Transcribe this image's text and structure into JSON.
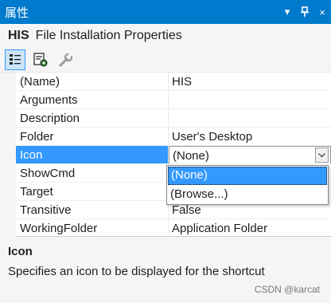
{
  "panel": {
    "title": "属性",
    "dropdown_glyph": "▾",
    "pin_glyph": "pin-icon",
    "close_glyph": "×"
  },
  "object": {
    "name": "HIS",
    "type": "File Installation Properties"
  },
  "toolbar": {
    "tools": [
      {
        "name": "categorized-icon",
        "active": true
      },
      {
        "name": "property-pages-icon",
        "active": false
      },
      {
        "name": "wrench-icon",
        "active": false
      }
    ]
  },
  "properties": [
    {
      "name": "(Name)",
      "value": "HIS"
    },
    {
      "name": "Arguments",
      "value": ""
    },
    {
      "name": "Description",
      "value": ""
    },
    {
      "name": "Folder",
      "value": "User's Desktop"
    },
    {
      "name": "Icon",
      "value": "(None)",
      "selected": true
    },
    {
      "name": "ShowCmd",
      "value": ""
    },
    {
      "name": "Target",
      "value": ""
    },
    {
      "name": "Transitive",
      "value": "False"
    },
    {
      "name": "WorkingFolder",
      "value": "Application Folder"
    }
  ],
  "dropdown": {
    "options": [
      "(None)",
      "(Browse...)"
    ],
    "highlighted": "(None)"
  },
  "description": {
    "title": "Icon",
    "text": "Specifies an icon to be displayed for the shortcut"
  },
  "watermark": "CSDN @karcat",
  "colors": {
    "accent": "#007acc",
    "selection": "#3399ff"
  }
}
